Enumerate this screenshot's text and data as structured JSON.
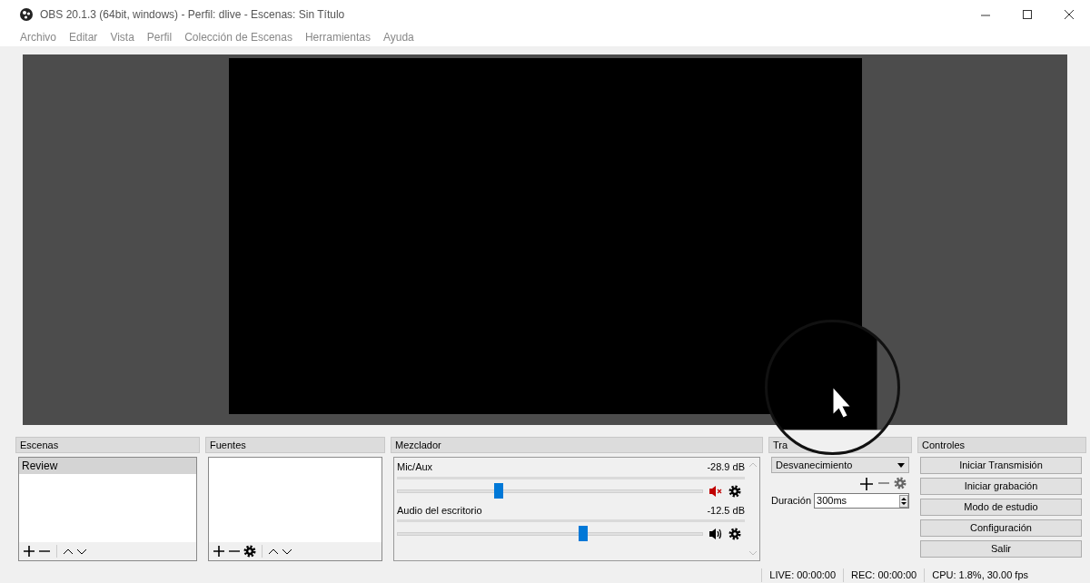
{
  "window": {
    "title": "OBS 20.1.3 (64bit, windows) - Perfil: dlive - Escenas: Sin Título"
  },
  "menu": [
    "Archivo",
    "Editar",
    "Vista",
    "Perfil",
    "Colección de Escenas",
    "Herramientas",
    "Ayuda"
  ],
  "scenes": {
    "title": "Escenas",
    "items": [
      {
        "label": "Review",
        "selected": true
      }
    ]
  },
  "sources": {
    "title": "Fuentes"
  },
  "mixer": {
    "title": "Mezclador",
    "channels": [
      {
        "name": "Mic/Aux",
        "reading": "-28.9 dB",
        "level": 0.33,
        "muted": true
      },
      {
        "name": "Audio del escritorio",
        "reading": "-12.5 dB",
        "level": 0.61,
        "muted": false
      }
    ]
  },
  "transitions": {
    "title": "Tra",
    "selected": "Desvanecimiento",
    "duration_label": "Duración",
    "duration": "300ms"
  },
  "controls": {
    "title": "Controles",
    "buttons": [
      "Iniciar Transmisión",
      "Iniciar grabación",
      "Modo de estudio",
      "Configuración",
      "Salir"
    ]
  },
  "status_bar": [
    "LIVE: 00:00:00",
    "REC: 00:00:00",
    "CPU: 1.8%, 30.00 fps"
  ]
}
